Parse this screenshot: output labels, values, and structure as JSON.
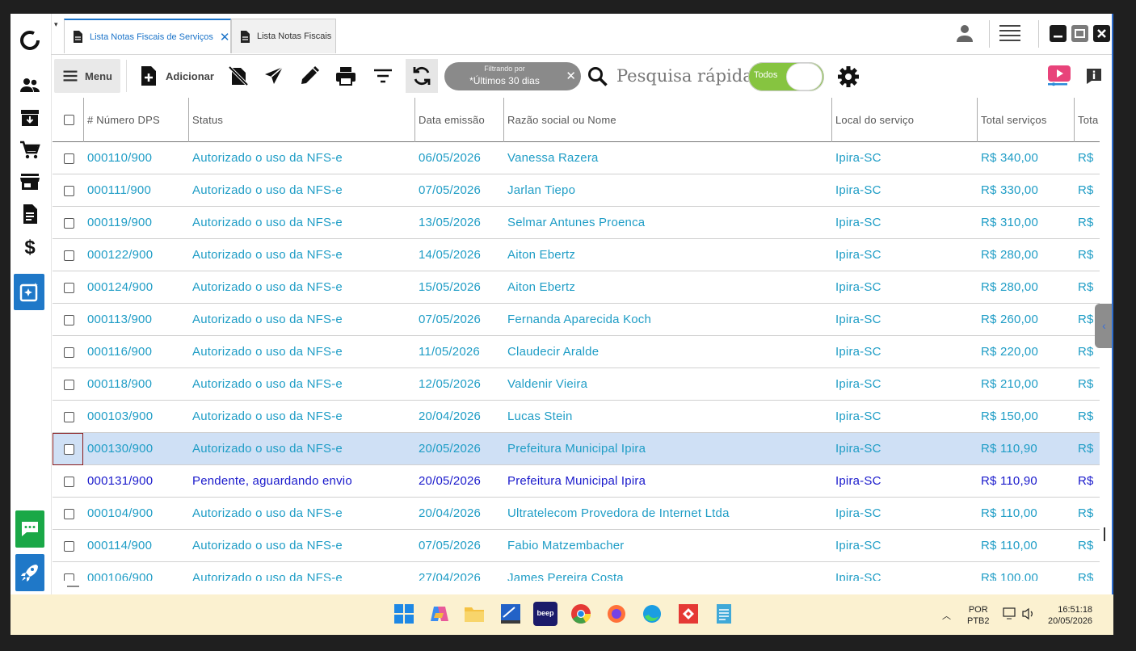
{
  "tabs": [
    {
      "label": "Lista Notas Fiscais de Serviços",
      "active": true
    },
    {
      "label": "Lista Notas Fiscais",
      "active": false
    }
  ],
  "toolbar": {
    "menu_label": "Menu",
    "add_label": "Adicionar",
    "filter_caption": "Filtrando por",
    "filter_value": "*Últimos 30 dias",
    "search_placeholder": "Pesquisa rápida",
    "toggle_label": "Todos"
  },
  "columns": [
    "# Número DPS",
    "Status",
    "Data emissão",
    "Razão social ou Nome",
    "Local do serviço",
    "Total serviços",
    "Tota"
  ],
  "rows": [
    {
      "numero": "000110/900",
      "status": "Autorizado o uso da NFS-e",
      "data": "06/05/2026",
      "nome": "Vanessa Razera",
      "local": "Ipira-SC",
      "total": "R$ 340,00",
      "total2": "R$",
      "state": "authorized"
    },
    {
      "numero": "000111/900",
      "status": "Autorizado o uso da NFS-e",
      "data": "07/05/2026",
      "nome": "Jarlan Tiepo",
      "local": "Ipira-SC",
      "total": "R$ 330,00",
      "total2": "R$",
      "state": "authorized"
    },
    {
      "numero": "000119/900",
      "status": "Autorizado o uso da NFS-e",
      "data": "13/05/2026",
      "nome": "Selmar Antunes Proenca",
      "local": "Ipira-SC",
      "total": "R$ 310,00",
      "total2": "R$",
      "state": "authorized"
    },
    {
      "numero": "000122/900",
      "status": "Autorizado o uso da NFS-e",
      "data": "14/05/2026",
      "nome": "Aiton Ebertz",
      "local": "Ipira-SC",
      "total": "R$ 280,00",
      "total2": "R$",
      "state": "authorized"
    },
    {
      "numero": "000124/900",
      "status": "Autorizado o uso da NFS-e",
      "data": "15/05/2026",
      "nome": "Aiton Ebertz",
      "local": "Ipira-SC",
      "total": "R$ 280,00",
      "total2": "R$",
      "state": "authorized"
    },
    {
      "numero": "000113/900",
      "status": "Autorizado o uso da NFS-e",
      "data": "07/05/2026",
      "nome": "Fernanda Aparecida Koch",
      "local": "Ipira-SC",
      "total": "R$ 260,00",
      "total2": "R$",
      "state": "authorized"
    },
    {
      "numero": "000116/900",
      "status": "Autorizado o uso da NFS-e",
      "data": "11/05/2026",
      "nome": "Claudecir Aralde",
      "local": "Ipira-SC",
      "total": "R$ 220,00",
      "total2": "R$",
      "state": "authorized"
    },
    {
      "numero": "000118/900",
      "status": "Autorizado o uso da NFS-e",
      "data": "12/05/2026",
      "nome": "Valdenir Vieira",
      "local": "Ipira-SC",
      "total": "R$ 210,00",
      "total2": "R$",
      "state": "authorized"
    },
    {
      "numero": "000103/900",
      "status": "Autorizado o uso da NFS-e",
      "data": "20/04/2026",
      "nome": "Lucas Stein",
      "local": "Ipira-SC",
      "total": "R$ 150,00",
      "total2": "R$",
      "state": "authorized"
    },
    {
      "numero": "000130/900",
      "status": "Autorizado o uso da NFS-e",
      "data": "20/05/2026",
      "nome": "Prefeitura Municipal Ipira",
      "local": "Ipira-SC",
      "total": "R$ 110,90",
      "total2": "R$",
      "state": "selected"
    },
    {
      "numero": "000131/900",
      "status": "Pendente, aguardando envio",
      "data": "20/05/2026",
      "nome": "Prefeitura Municipal Ipira",
      "local": "Ipira-SC",
      "total": "R$ 110,90",
      "total2": "R$",
      "state": "pending"
    },
    {
      "numero": "000104/900",
      "status": "Autorizado o uso da NFS-e",
      "data": "20/04/2026",
      "nome": "Ultratelecom Provedora de Internet Ltda",
      "local": "Ipira-SC",
      "total": "R$ 110,00",
      "total2": "R$",
      "state": "authorized"
    },
    {
      "numero": "000114/900",
      "status": "Autorizado o uso da NFS-e",
      "data": "07/05/2026",
      "nome": "Fabio Matzembacher",
      "local": "Ipira-SC",
      "total": "R$ 110,00",
      "total2": "R$",
      "state": "authorized"
    },
    {
      "numero": "000106/900",
      "status": "Autorizado o uso da NFS-e",
      "data": "27/04/2026",
      "nome": "James Pereira Costa",
      "local": "Ipira-SC",
      "total": "R$ 100,00",
      "total2": "R$",
      "state": "authorized"
    }
  ],
  "taskbar": {
    "lang_line1": "POR",
    "lang_line2": "PTB2",
    "time": "16:51:18",
    "date": "20/05/2026",
    "beep_label": "beep"
  },
  "colors": {
    "authorized": "#1f9dc6",
    "pending": "#1a1acc",
    "selected_row": "#cfe0f5",
    "toggle_on": "#86c440",
    "accent": "#1a73c9"
  }
}
